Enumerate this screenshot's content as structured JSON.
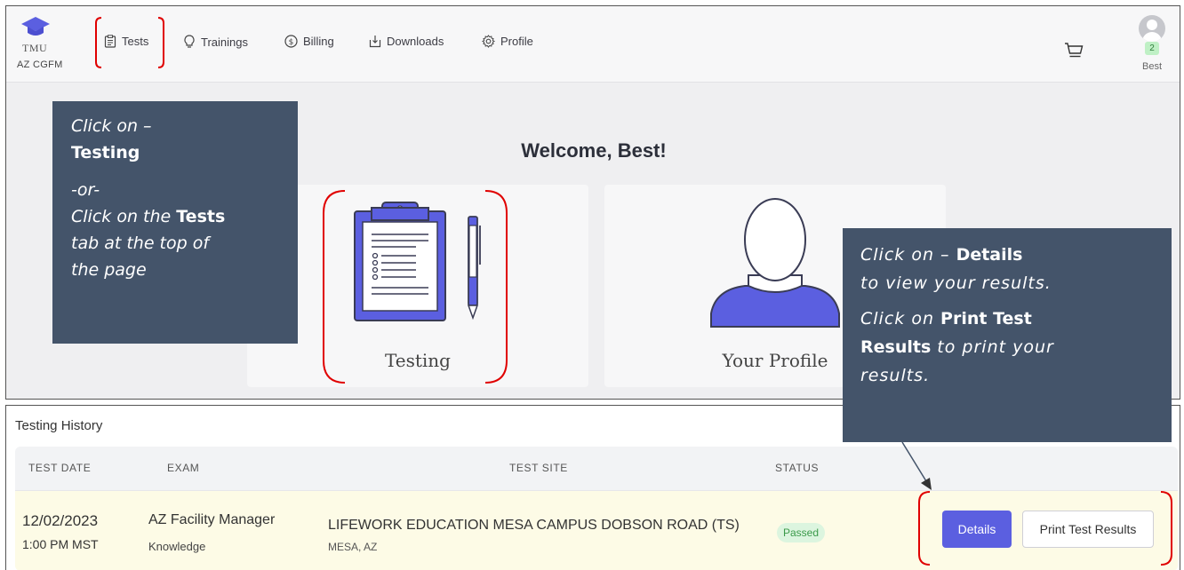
{
  "logo": {
    "name": "TMU",
    "subtitle": "AZ CGFM"
  },
  "nav": [
    {
      "label": "Tests",
      "icon": "clipboard-icon"
    },
    {
      "label": "Trainings",
      "icon": "lightbulb-icon"
    },
    {
      "label": "Billing",
      "icon": "dollar-icon"
    },
    {
      "label": "Downloads",
      "icon": "download-icon"
    },
    {
      "label": "Profile",
      "icon": "gear-icon"
    }
  ],
  "user": {
    "name": "Best",
    "badge": "2"
  },
  "welcome": "Welcome, Best!",
  "cards": [
    {
      "label": "Testing",
      "icon": "clipboard-pen-icon"
    },
    {
      "label": "Your Profile",
      "icon": "person-icon"
    }
  ],
  "callout_left": {
    "l1": "Click on –",
    "l2": "Testing",
    "l3": "-or-",
    "l4a": "Click on the ",
    "l4b": "Tests",
    "l5": "tab at the top of",
    "l6": "the page"
  },
  "callout_right": {
    "l1a": "Click on – ",
    "l1b": "Details",
    "l2": "to view your results.",
    "l3a": "Click on ",
    "l3b": "Print Test",
    "l4a": "Results",
    "l4b": " to print your",
    "l5": "results."
  },
  "history": {
    "title": "Testing History",
    "columns": [
      "TEST DATE",
      "EXAM",
      "TEST SITE",
      "STATUS"
    ],
    "rows": [
      {
        "date": "12/02/2023",
        "time": "1:00 PM MST",
        "exam": "AZ Facility Manager",
        "exam_type": "Knowledge",
        "site": "LIFEWORK EDUCATION MESA CAMPUS DOBSON ROAD (TS)",
        "site_location": "MESA, AZ",
        "status": "Passed",
        "details_label": "Details",
        "print_label": "Print Test Results"
      }
    ]
  },
  "colors": {
    "accent": "#5b5fe0",
    "callout_bg": "#44546a",
    "annotation_red": "#e00000",
    "status_green": "#3b9a4a",
    "row_highlight": "#fdfbe6"
  }
}
